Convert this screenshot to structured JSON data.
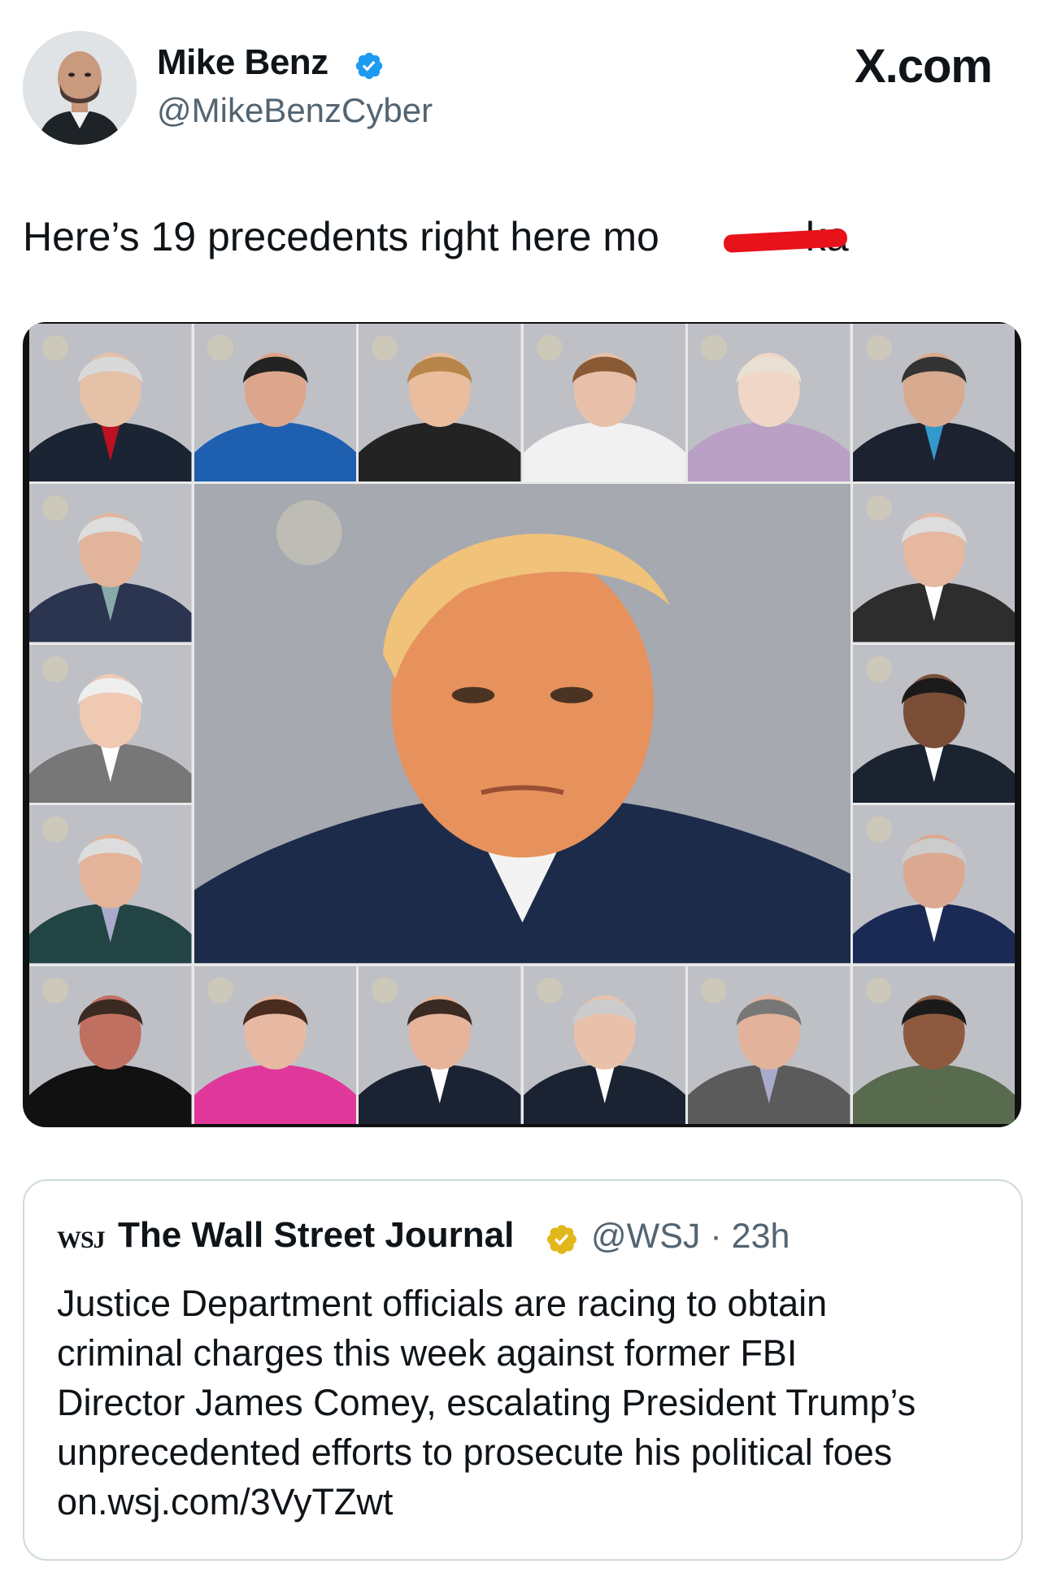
{
  "header": {
    "display_name": "Mike Benz",
    "handle": "@MikeBenzCyber",
    "watermark": "X.com"
  },
  "tweet": {
    "text_before_redaction": "Here’s 19 precedents right here mo",
    "text_after_redaction": "ka"
  },
  "quoted_tweet": {
    "logo": "WSJ",
    "name": "The Wall Street Journal",
    "handle": "@WSJ",
    "separator": "·",
    "time": "23h",
    "lines": [
      "Justice Department officials are racing to obtain",
      "criminal charges this week against former FBI",
      "Director James Comey, escalating President Trump’s",
      "unprecedented efforts to prosecute his political foes",
      "on.wsj.com/3VyTZwt"
    ]
  },
  "colors": {
    "verified_blue": "#1d9bf0",
    "verified_gold": "#e2b719",
    "redaction_red": "#e8121b",
    "muted_text": "#536471"
  }
}
